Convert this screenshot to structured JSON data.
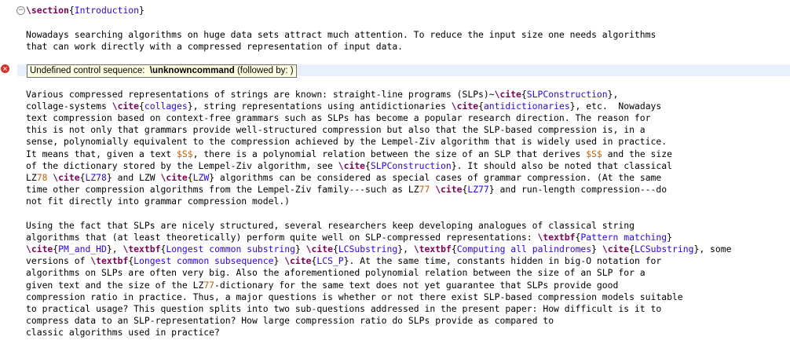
{
  "section": {
    "command": "\\section",
    "title": "Introduction"
  },
  "p1": [
    "Nowadays searching algorithms on huge data sets attract much attention. To reduce the input size one needs algorithms",
    "that can work directly with a compressed representation of input data."
  ],
  "error": {
    "prefix": "Undefined control sequence:  ",
    "command": "\\unknowncommand",
    "suffix": " (followed by: )"
  },
  "p2": [
    [
      {
        "t": "Various compressed representations of strings are known: straight-line programs (SLPs)~"
      },
      {
        "c": "\\cite"
      },
      {
        "a": "SLPConstruction"
      },
      {
        "t": ","
      }
    ],
    [
      {
        "t": "collage-systems "
      },
      {
        "c": "\\cite"
      },
      {
        "a": "collages"
      },
      {
        "t": ", string representations using antidictionaries "
      },
      {
        "c": "\\cite"
      },
      {
        "a": "antidictionaries"
      },
      {
        "t": ", etc.  Nowadays"
      }
    ],
    [
      {
        "t": "text compression based on context-free grammars such as SLPs has become a popular research direction. The reason for"
      }
    ],
    [
      {
        "t": "this is not only that grammars provide well-structured compression but also that the SLP-based compression is, in a"
      }
    ],
    [
      {
        "t": "sense, polynomially equivalent to the compression achieved by the Lempel-Ziv algorithm that is widely used in practice."
      }
    ],
    [
      {
        "t": "It means that, given a text "
      },
      {
        "m": "$S$"
      },
      {
        "t": ", there is a polynomial relation between the size of an SLP that derives "
      },
      {
        "m": "$S$"
      },
      {
        "t": " and the size"
      }
    ],
    [
      {
        "t": "of the dictionary stored by the Lempel-Ziv algorithm, see "
      },
      {
        "c": "\\cite"
      },
      {
        "a": "SLPConstruction"
      },
      {
        "t": ". It should also be noted that classical"
      }
    ],
    [
      {
        "t": "LZ"
      },
      {
        "m": "78"
      },
      {
        "t": " "
      },
      {
        "c": "\\cite"
      },
      {
        "a": "LZ78"
      },
      {
        "t": " and LZW "
      },
      {
        "c": "\\cite"
      },
      {
        "a": "LZW"
      },
      {
        "t": " algorithms can be considered as special cases of grammar compression. (At the same"
      }
    ],
    [
      {
        "t": "time other compression algorithms from the Lempel-Ziv family---such as LZ"
      },
      {
        "m": "77"
      },
      {
        "t": " "
      },
      {
        "c": "\\cite"
      },
      {
        "a": "LZ77"
      },
      {
        "t": " and run-length compression---do"
      }
    ],
    [
      {
        "t": "not fit directly into grammar compression model.)"
      }
    ]
  ],
  "p3": [
    [
      {
        "t": "Using the fact that SLPs are nicely structured, several researchers keep developing analogues of classical string"
      }
    ],
    [
      {
        "t": "algorithms that (at least theoretically) perform quite well on SLP-compressed representations: "
      },
      {
        "c": "\\textbf"
      },
      {
        "a": "Pattern matching"
      }
    ],
    [
      {
        "c": "\\cite"
      },
      {
        "a": "PM_and_HD"
      },
      {
        "t": ", "
      },
      {
        "c": "\\textbf"
      },
      {
        "a": "Longest common substring"
      },
      {
        "t": " "
      },
      {
        "c": "\\cite"
      },
      {
        "a": "LCSubstring"
      },
      {
        "t": ", "
      },
      {
        "c": "\\textbf"
      },
      {
        "a": "Computing all palindromes"
      },
      {
        "t": " "
      },
      {
        "c": "\\cite"
      },
      {
        "a": "LCSubstring"
      },
      {
        "t": ", some"
      }
    ],
    [
      {
        "t": "versions of "
      },
      {
        "c": "\\textbf"
      },
      {
        "a": "Longest common subsequence"
      },
      {
        "t": " "
      },
      {
        "c": "\\cite"
      },
      {
        "a": "LCS_P"
      },
      {
        "t": ". At the same time, constants hidden in big-O notation for"
      }
    ],
    [
      {
        "t": "algorithms on SLPs are often very big. Also the aforementioned polynomial relation between the size of an SLP for a"
      }
    ],
    [
      {
        "t": "given text and the size of the LZ"
      },
      {
        "m": "77"
      },
      {
        "t": "-dictionary for the same text does not yet guarantee that SLPs provide good"
      }
    ],
    [
      {
        "t": "compression ratio in practice. Thus, a major questions is whether or not there exist SLP-based compression models suitable"
      }
    ],
    [
      {
        "t": "to practical usage? This question splits into two sub-questions addressed in the present paper: How difficult is it to"
      }
    ],
    [
      {
        "t": "compress data to an SLP-representation? How large compression ratio do SLPs provide as compared to"
      }
    ],
    [
      {
        "t": "classic algorithms used in practice?"
      }
    ]
  ],
  "colors": {
    "command": "#7f0055",
    "argument": "#2a00ff",
    "math": "#c45f00",
    "current_line": "#e8f0fb",
    "tooltip_bg": "#ffffe1",
    "error": "#d93025"
  },
  "icons": {
    "fold": "collapse-icon",
    "error": "error-icon"
  }
}
